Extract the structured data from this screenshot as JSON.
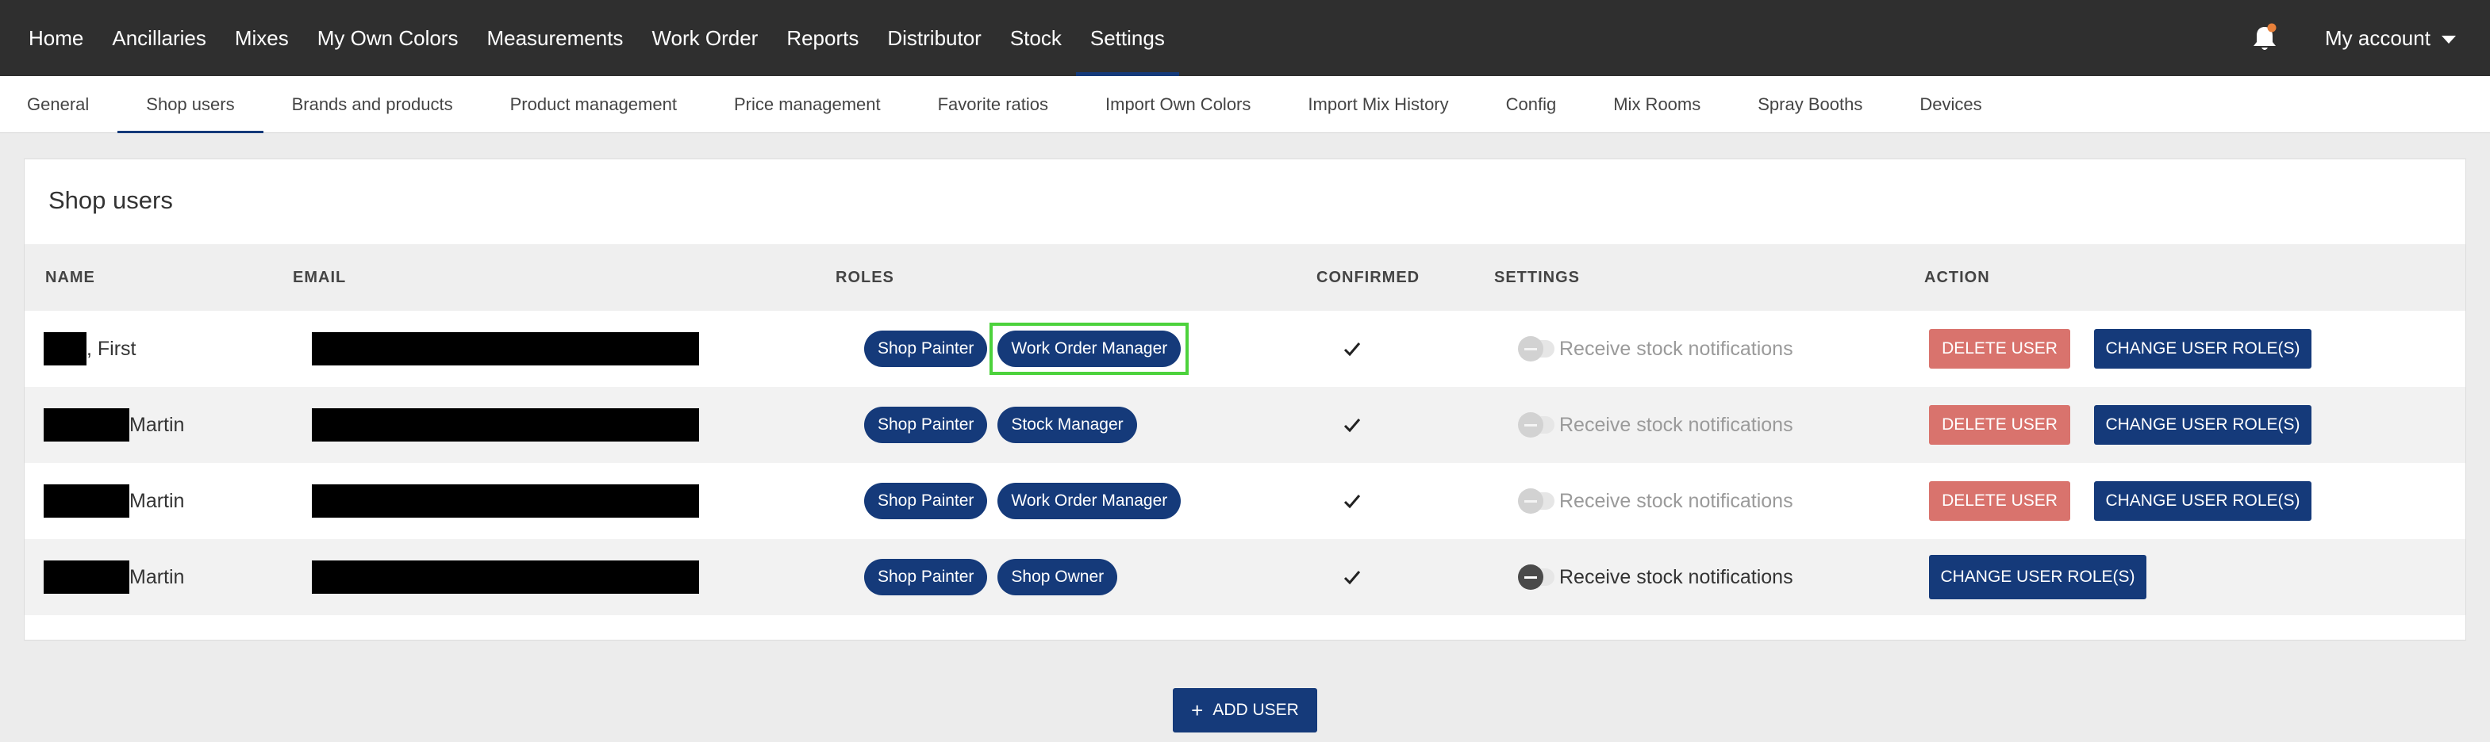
{
  "topnav": {
    "items": [
      "Home",
      "Ancillaries",
      "Mixes",
      "My Own Colors",
      "Measurements",
      "Work Order",
      "Reports",
      "Distributor",
      "Stock",
      "Settings"
    ],
    "active_index": 9,
    "account_label": "My account",
    "notification_icon": "bell-icon"
  },
  "subnav": {
    "items": [
      "General",
      "Shop users",
      "Brands and products",
      "Product management",
      "Price management",
      "Favorite ratios",
      "Import Own Colors",
      "Import Mix History",
      "Config",
      "Mix Rooms",
      "Spray Booths",
      "Devices"
    ],
    "active_index": 1
  },
  "card": {
    "title": "Shop users",
    "columns": [
      "NAME",
      "EMAIL",
      "ROLES",
      "CONFIRMED",
      "SETTINGS",
      "ACTION"
    ]
  },
  "users": [
    {
      "name_suffix": ", First",
      "roles": [
        "Shop Painter",
        "Work Order Manager"
      ],
      "confirmed": true,
      "setting_label": "Receive stock notifications",
      "setting_on": false,
      "can_delete": true
    },
    {
      "name_suffix": "Martin",
      "roles": [
        "Shop Painter",
        "Stock Manager"
      ],
      "confirmed": true,
      "setting_label": "Receive stock notifications",
      "setting_on": false,
      "can_delete": true
    },
    {
      "name_suffix": "Martin",
      "roles": [
        "Shop Painter",
        "Work Order Manager"
      ],
      "confirmed": true,
      "setting_label": "Receive stock notifications",
      "setting_on": false,
      "can_delete": true
    },
    {
      "name_suffix": "Martin",
      "roles": [
        "Shop Painter",
        "Shop Owner"
      ],
      "confirmed": true,
      "setting_label": "Receive stock notifications",
      "setting_on": true,
      "can_delete": false
    }
  ],
  "actions": {
    "delete_label": "DELETE USER",
    "change_role_label": "CHANGE USER ROLE(S)",
    "add_user_label": "ADD USER"
  },
  "colors": {
    "primary": "#153a7a",
    "danger": "#d9736d",
    "topbar": "#2f2f2f",
    "highlight": "#4cd23c"
  }
}
